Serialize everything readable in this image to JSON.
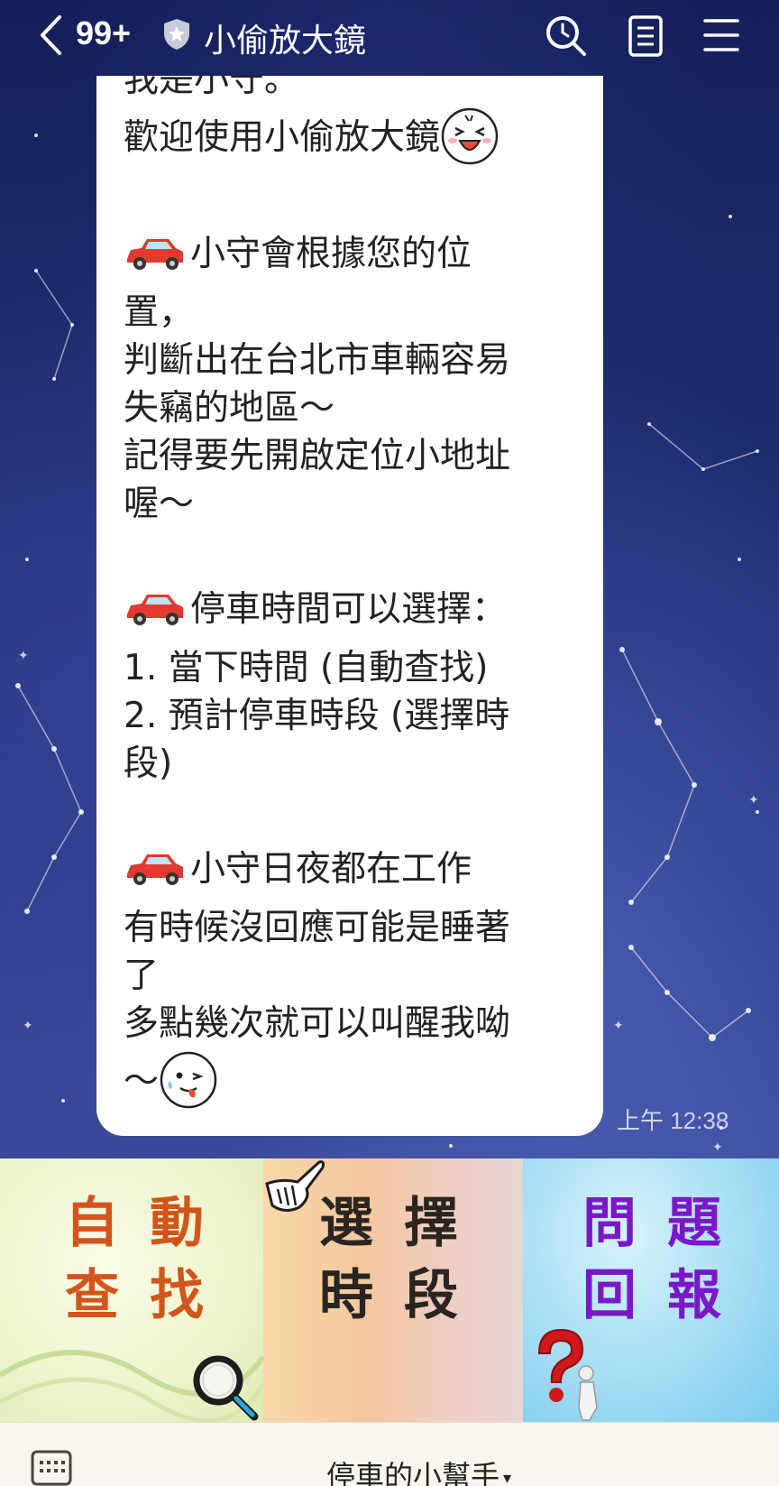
{
  "header": {
    "unread_count": "99+",
    "chat_title": "小偷放大鏡"
  },
  "message": {
    "lines": [
      "我是小守。",
      "歡迎使用小偷放大鏡",
      "小守會根據您的位",
      "置，",
      "判斷出在台北市車輛容易",
      "失竊的地區～",
      "記得要先開啟定位小地址",
      "喔～",
      "停車時間可以選擇：",
      "1. 當下時間 (自動查找)",
      "2. 預計停車時段 (選擇時",
      "段)",
      "小守日夜都在工作",
      "有時候沒回應可能是睡著",
      "了",
      "多點幾次就可以叫醒我呦",
      "～"
    ],
    "timestamp": "上午 12:38"
  },
  "rich_menu": {
    "tiles": [
      {
        "line1": "自動",
        "line2": "查找",
        "color": "#d2551c"
      },
      {
        "line1": "選擇",
        "line2": "時段",
        "color": "#2a2520"
      },
      {
        "line1": "問題",
        "line2": "回報",
        "color": "#7a18c8"
      }
    ]
  },
  "bottom_bar": {
    "menu_title": "停車的小幫手",
    "caret": "▾"
  },
  "icons": [
    "back-arrow-icon",
    "shield-badge-icon",
    "search-icon",
    "notes-icon",
    "hamburger-menu-icon",
    "car-emoji-icon",
    "laughing-face-emoji-icon",
    "tongue-face-emoji-icon",
    "pointing-hand-icon",
    "magnifier-icon",
    "question-mark-figure-icon",
    "keyboard-icon"
  ]
}
